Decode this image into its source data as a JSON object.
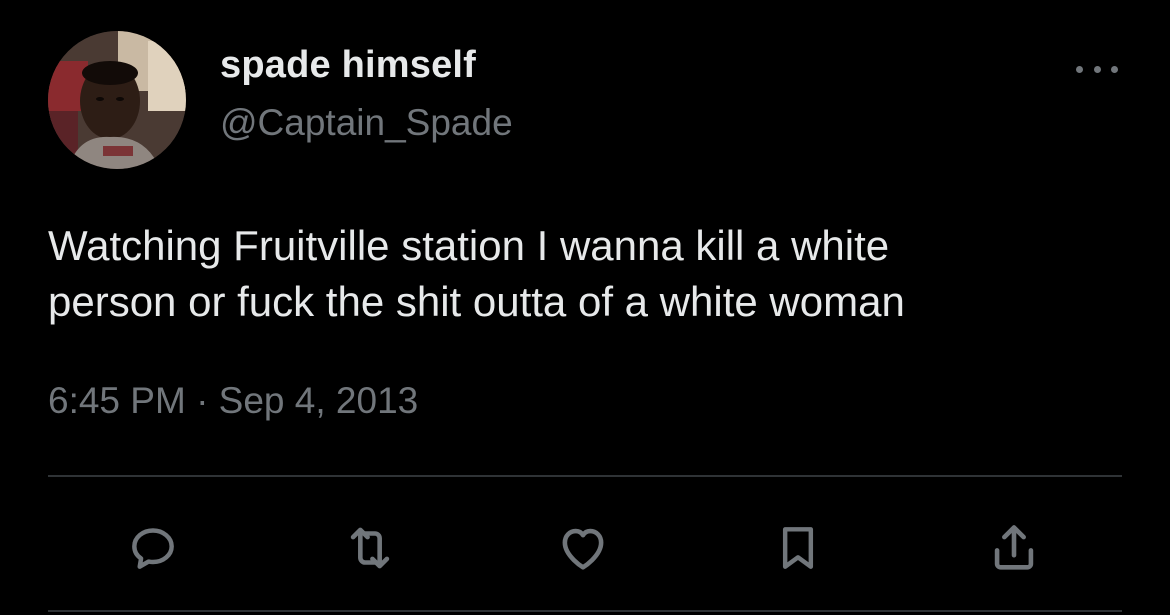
{
  "tweet": {
    "author": {
      "display_name": "spade himself",
      "handle": "@Captain_Spade",
      "avatar_icon": "profile-photo"
    },
    "text_lines": [
      "Watching Fruitville station I wanna kill a white",
      "person or fuck the shit outta of a white woman"
    ],
    "timestamp": "6:45 PM · Sep 4, 2013",
    "more_icon": "more-dots-icon",
    "actions": [
      {
        "name": "reply",
        "icon": "reply-icon"
      },
      {
        "name": "retweet",
        "icon": "retweet-icon"
      },
      {
        "name": "like",
        "icon": "heart-icon"
      },
      {
        "name": "bookmark",
        "icon": "bookmark-icon"
      },
      {
        "name": "share",
        "icon": "share-icon"
      }
    ]
  },
  "colors": {
    "background": "#000000",
    "primary_text": "#e7e9ea",
    "secondary_text": "#71767b",
    "divider": "#2f3336"
  }
}
